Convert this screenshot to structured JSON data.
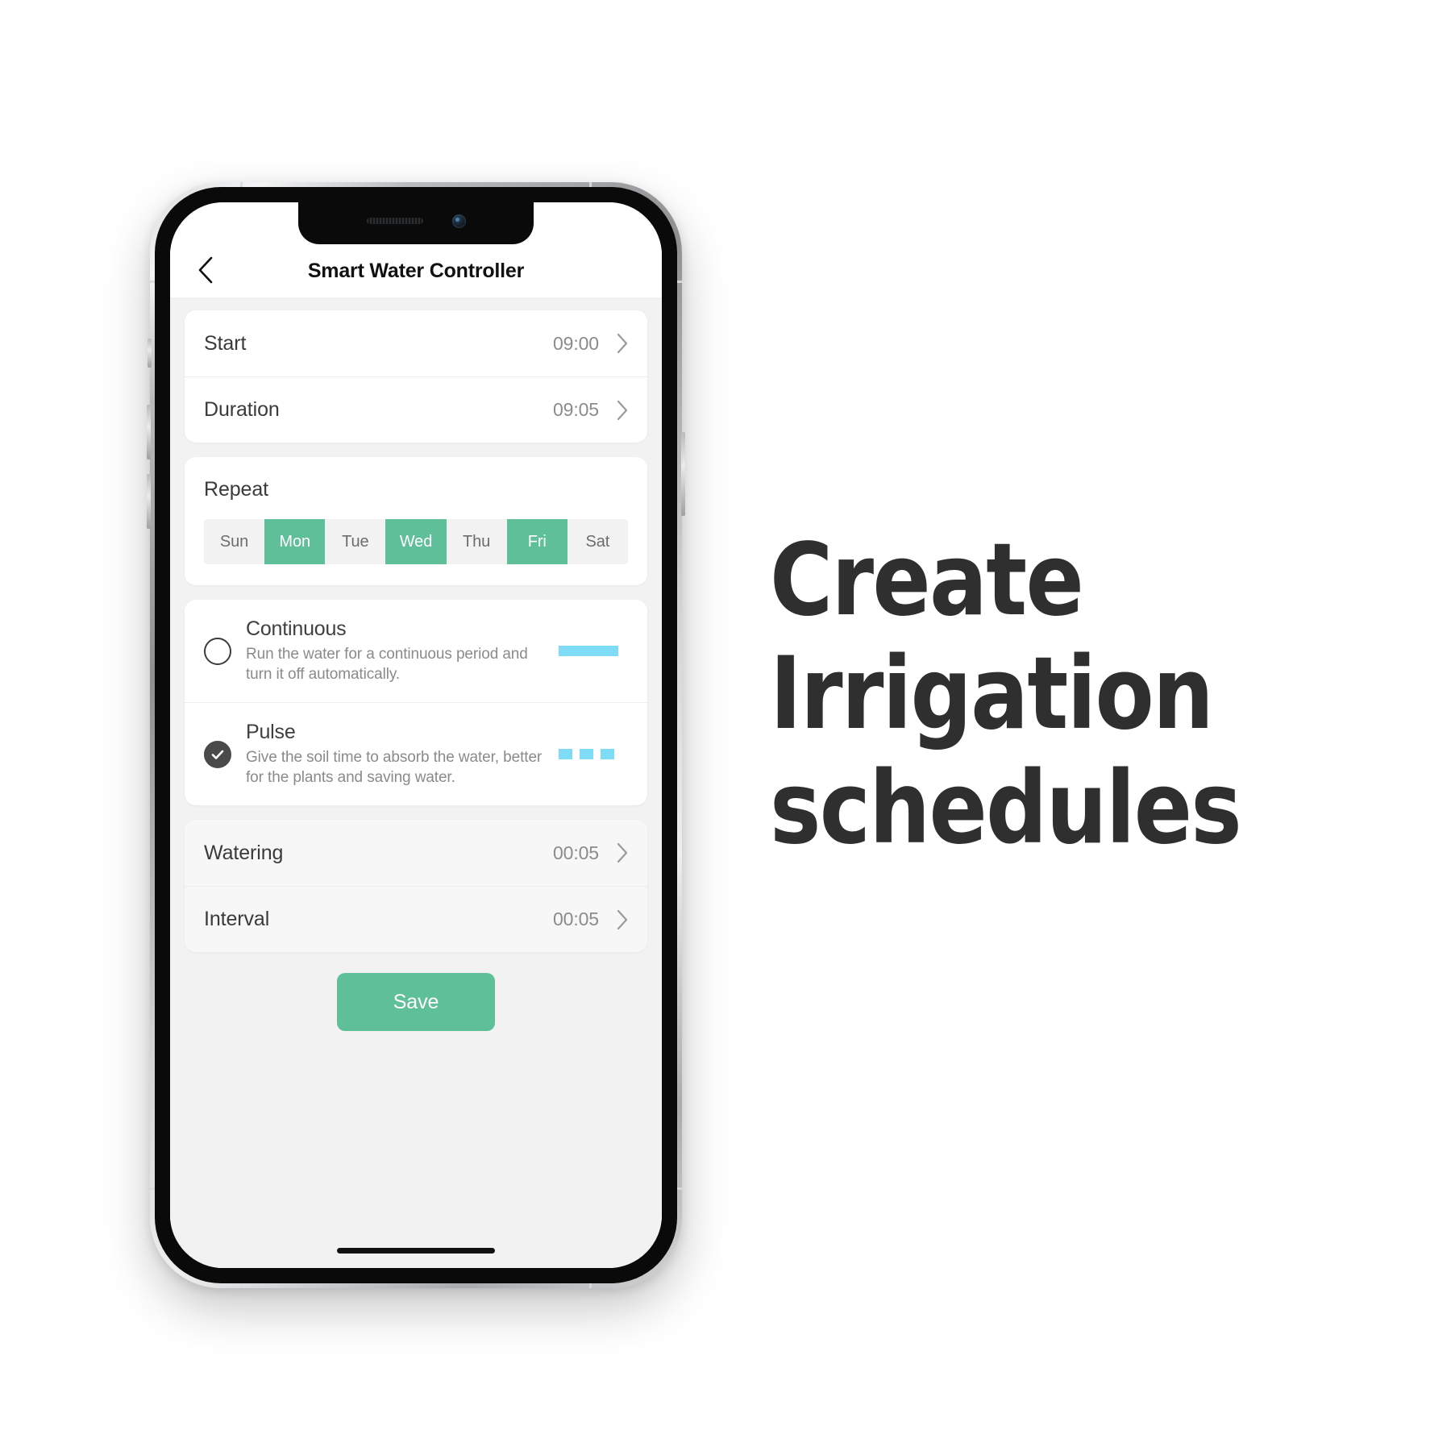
{
  "phone": {
    "status_icons": [
      "speaker-grille",
      "front-camera"
    ],
    "home_indicator": true
  },
  "app": {
    "navbar": {
      "back_icon": "chevron-left-icon",
      "title": "Smart Water Controller"
    },
    "schedule_rows": [
      {
        "label": "Start",
        "value": "09:00",
        "chevron": "chevron-right-icon"
      },
      {
        "label": "Duration",
        "value": "09:05",
        "chevron": "chevron-right-icon"
      }
    ],
    "repeat": {
      "title": "Repeat",
      "days": [
        {
          "label": "Sun",
          "selected": false
        },
        {
          "label": "Mon",
          "selected": true
        },
        {
          "label": "Tue",
          "selected": false
        },
        {
          "label": "Wed",
          "selected": true
        },
        {
          "label": "Thu",
          "selected": false
        },
        {
          "label": "Fri",
          "selected": true
        },
        {
          "label": "Sat",
          "selected": false
        }
      ]
    },
    "modes": [
      {
        "title": "Continuous",
        "description": "Run the water for a continuous period and turn it off automatically.",
        "selected": false,
        "graphic": "solid-bar"
      },
      {
        "title": "Pulse",
        "description": "Give the soil time to absorb the water, better for the plants and saving water.",
        "selected": true,
        "graphic": "dashed-bars"
      }
    ],
    "pulse_rows": [
      {
        "label": "Watering",
        "value": "00:05",
        "chevron": "chevron-right-icon"
      },
      {
        "label": "Interval",
        "value": "00:05",
        "chevron": "chevron-right-icon"
      }
    ],
    "save_label": "Save"
  },
  "marketing": {
    "headline_lines": [
      "Create",
      "Irrigation",
      "schedules"
    ]
  },
  "colors": {
    "accent_green": "#5fbf98",
    "accent_cyan": "#7fdcf7",
    "screen_bg": "#f2f2f2",
    "card_bg": "#ffffff",
    "text_primary": "#3a3a3a",
    "text_secondary": "#8b8b8b",
    "headline": "#2f2f2f"
  }
}
